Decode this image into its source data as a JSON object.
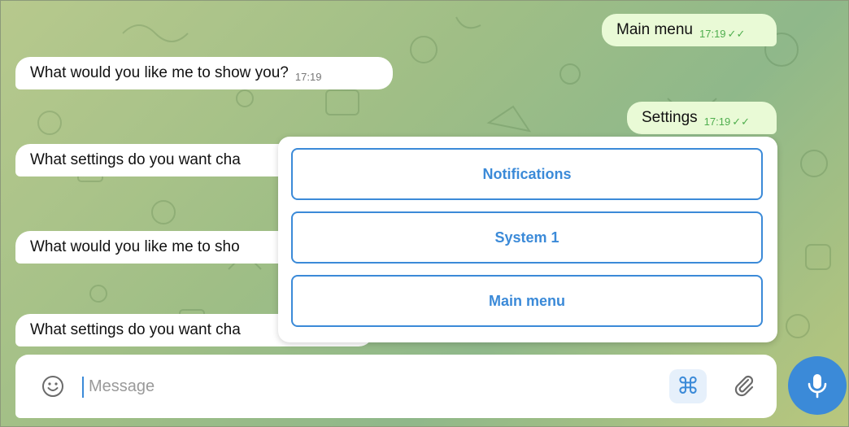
{
  "messages": [
    {
      "dir": "out",
      "text": "Main menu",
      "time": "17:19"
    },
    {
      "dir": "in",
      "text": "What would you like me to show you?",
      "time": "17:19"
    },
    {
      "dir": "out",
      "text": "Settings",
      "time": "17:19"
    },
    {
      "dir": "in",
      "text": "What settings do you want cha",
      "time": ""
    },
    {
      "dir": "in",
      "text": "What would you like me to sho",
      "time": ""
    },
    {
      "dir": "in",
      "text": "What settings do you want cha",
      "time": ""
    }
  ],
  "keyboard": {
    "buttons": [
      "Notifications",
      "System 1",
      "Main menu"
    ]
  },
  "composer": {
    "placeholder": "Message",
    "command_icon": "⌘"
  },
  "colors": {
    "accent": "#3b8ad8",
    "outgoing_bubble": "#e9fad6",
    "incoming_bubble": "#ffffff",
    "read_ticks": "#4fae4e"
  },
  "icons": [
    "emoji-icon",
    "command-icon",
    "paperclip-icon",
    "microphone-icon",
    "double-check-icon"
  ]
}
